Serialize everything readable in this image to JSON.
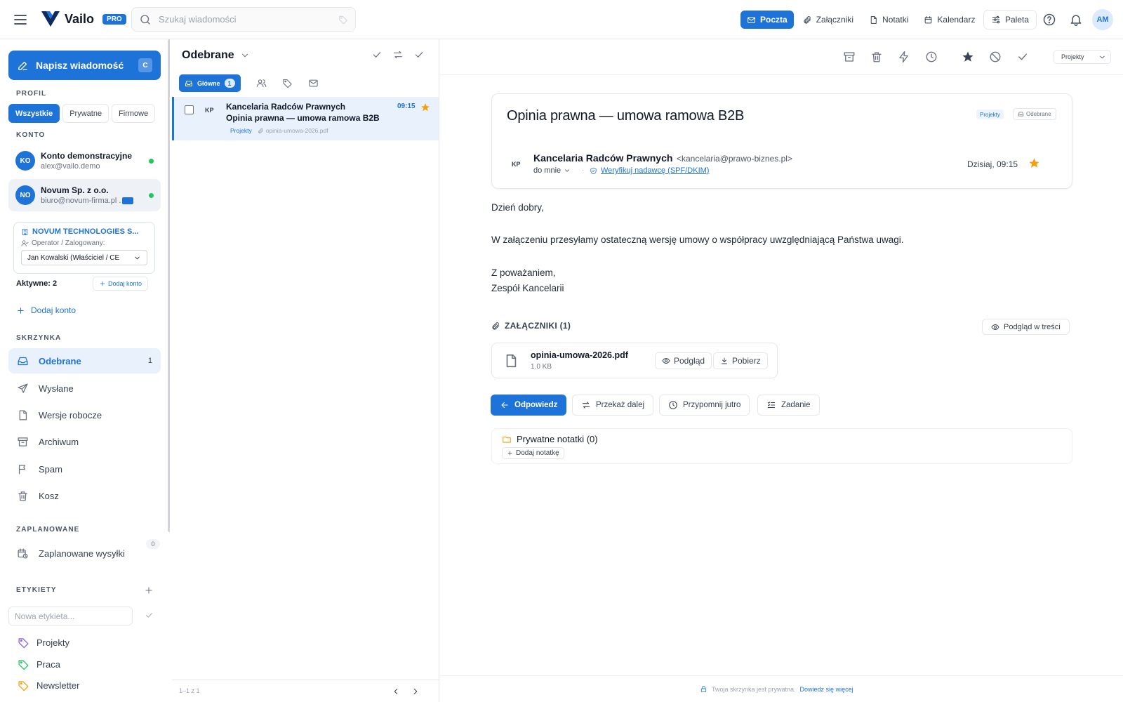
{
  "app": {
    "name": "Vailo",
    "badge": "PRO",
    "search_placeholder": "Szukaj wiadomości",
    "nav_tabs": [
      {
        "label": "Poczta",
        "icon": "mail-icon",
        "active": true
      },
      {
        "label": "Załączniki",
        "icon": "paperclip-icon",
        "active": false
      },
      {
        "label": "Notatki",
        "icon": "note-icon",
        "active": false
      },
      {
        "label": "Kalendarz",
        "icon": "calendar-icon",
        "active": false
      }
    ],
    "palette_label": "Paleta",
    "user_initials": "AM",
    "accent_color": "#1e73d8"
  },
  "sidebar": {
    "compose_label": "Napisz wiadomość",
    "compose_shortcut": "C",
    "profile_title": "PROFIL",
    "profile_tabs": [
      "Wszystkie",
      "Prywatne",
      "Firmowe"
    ],
    "account_title": "KONTO",
    "accounts": [
      {
        "initials": "KO",
        "name": "Konto demonstracyjne",
        "email": "alex@vailo.demo"
      },
      {
        "initials": "NO",
        "name": "Novum Sp. z o.o.",
        "email": "biuro@novum-firma.pl ."
      }
    ],
    "org": {
      "name": "NOVUM TECHNOLOGIES S...",
      "operator_label": "Operator / Zalogowany:",
      "operator_value": "Jan Kowalski (Właściciel / CE"
    },
    "active_count": "Aktywne: 2",
    "add_account_small": "Dodaj konto",
    "add_account": "Dodaj konto",
    "mailbox_title": "SKRZYNKA",
    "folders": [
      {
        "label": "Odebrane",
        "icon": "inbox-icon",
        "count": "1"
      },
      {
        "label": "Wysłane",
        "icon": "send-icon",
        "count": ""
      },
      {
        "label": "Wersje robocze",
        "icon": "file-icon",
        "count": ""
      },
      {
        "label": "Archiwum",
        "icon": "archive-icon",
        "count": ""
      },
      {
        "label": "Spam",
        "icon": "flag-icon",
        "count": ""
      },
      {
        "label": "Kosz",
        "icon": "trash-icon",
        "count": ""
      }
    ],
    "scheduled_title": "ZAPLANOWANE",
    "scheduled_count": "0",
    "scheduled_item": "Zaplanowane wysyłki",
    "labels_title": "ETYKIETY",
    "label_placeholder": "Nowa etykieta...",
    "labels": [
      {
        "name": "Projekty",
        "color": "#8b5cf6"
      },
      {
        "name": "Praca",
        "color": "#22c55e"
      },
      {
        "name": "Newsletter",
        "color": "#f59e0b"
      }
    ]
  },
  "list": {
    "folder_title": "Odebrane",
    "main_tab": "Główne",
    "main_tab_count": "1",
    "messages": [
      {
        "initials": "KP",
        "from": "Kancelaria Radców Prawnych",
        "subject": "Opinia prawna — umowa ramowa B2B",
        "tag": "Projekty",
        "attachment": "opinia-umowa-2026.pdf",
        "time": "09:15",
        "starred": true
      }
    ],
    "pager": "1–1 z 1"
  },
  "reader": {
    "folder_select": "Projekty",
    "subject": "Opinia prawna — umowa ramowa B2B",
    "chip_tag": "Projekty",
    "chip_folder": "Odebrane",
    "sender_initials": "KP",
    "sender_name": "Kancelaria Radców Prawnych",
    "sender_email": "<kancelaria@prawo-biznes.pl>",
    "to": "do mnie",
    "separator": "·",
    "verify_link": "Weryfikuj nadawcę (SPF/DKIM)",
    "date": "Dzisiaj, 09:15",
    "body": [
      "Dzień dobry,",
      "W załączeniu przesyłamy ostateczną wersję umowy o współpracy uwzględniającą Państwa uwagi.",
      "Z poważaniem,",
      "Zespół Kancelarii"
    ],
    "attachments_title": "ZAŁĄCZNIKI (1)",
    "inline_preview": "Podgląd w treści",
    "attachment": {
      "name": "opinia-umowa-2026.pdf",
      "size": "1.0 KB",
      "preview": "Podgląd",
      "download": "Pobierz"
    },
    "actions": {
      "reply": "Odpowiedz",
      "forward": "Przekaż dalej",
      "remind": "Przypomnij jutro",
      "task": "Zadanie"
    },
    "notes_title": "Prywatne notatki (0)",
    "notes_add": "Dodaj notatkę",
    "privacy_text": "Twoja skrzynka jest prywatna.",
    "privacy_link": "Dowiedz się więcej"
  }
}
